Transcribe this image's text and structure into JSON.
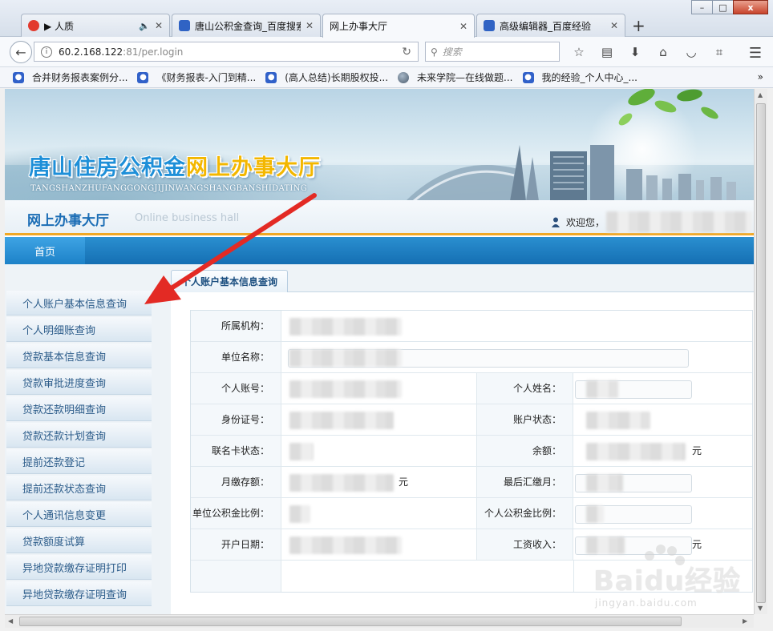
{
  "browser": {
    "tabs": [
      {
        "label": "▶ 人质",
        "icon_color": "#e23a2e",
        "active": false
      },
      {
        "label": "唐山公积金查询_百度搜索",
        "icon_color": "#3063c4",
        "active": false
      },
      {
        "label": "网上办事大厅",
        "icon_color": "",
        "active": true
      },
      {
        "label": "高级编辑器_百度经验",
        "icon_color": "#3063c4",
        "active": false
      }
    ],
    "window_buttons": {
      "minimize": "–",
      "maximize": "□",
      "close": "x"
    },
    "url_main": "60.2.168.122",
    "url_rest": ":81/per.login",
    "search_placeholder": "搜索",
    "bookmarks": [
      {
        "label": "合并财务报表案例分...",
        "icon": "paw-icon"
      },
      {
        "label": "《财务报表-入门到精...",
        "icon": "paw-icon"
      },
      {
        "label": "(高人总结)长期股权投...",
        "icon": "paw-icon"
      },
      {
        "label": "未来学院—在线做题...",
        "icon": "globe-icon"
      },
      {
        "label": "我的经验_个人中心_...",
        "icon": "paw-icon"
      }
    ],
    "bookmarks_more": "»",
    "new_tab": "+"
  },
  "site": {
    "banner_title_a": "唐山住房公积金",
    "banner_title_b": "网上办事大厅",
    "banner_subtitle": "TANGSHANZHUFANGGONGJIJINWANGSHANGBANSHIDATING",
    "hall_title": "网上办事大厅",
    "hall_en": "Online business hall",
    "welcome": "欢迎您，",
    "nav_home": "首页"
  },
  "sidebar": {
    "items": [
      "个人账户基本信息查询",
      "个人明细账查询",
      "贷款基本信息查询",
      "贷款审批进度查询",
      "贷款还款明细查询",
      "贷款还款计划查询",
      "提前还款登记",
      "提前还款状态查询",
      "个人通讯信息变更",
      "贷款额度试算",
      "异地贷款缴存证明打印",
      "异地贷款缴存证明查询"
    ]
  },
  "panel": {
    "tab_label": "个人账户基本信息查询",
    "labels": {
      "org": "所属机构：",
      "company": "单位名称：",
      "account_no": "个人账号：",
      "name": "个人姓名：",
      "id_no": "身份证号：",
      "account_status": "账户状态：",
      "card_status": "联名卡状态：",
      "balance": "余额：",
      "monthly": "月缴存额：",
      "last_month": "最后汇缴月：",
      "company_ratio": "单位公积金比例：",
      "personal_ratio": "个人公积金比例：",
      "open_date": "开户日期：",
      "salary": "工资收入："
    },
    "unit_yuan": "元"
  },
  "watermark": {
    "brand": "Baidu经验",
    "url": "jingyan.baidu.com"
  },
  "colors": {
    "nav_blue": "#156fb3",
    "accent_orange": "#f0a825",
    "annotation_red": "#e32a24"
  }
}
